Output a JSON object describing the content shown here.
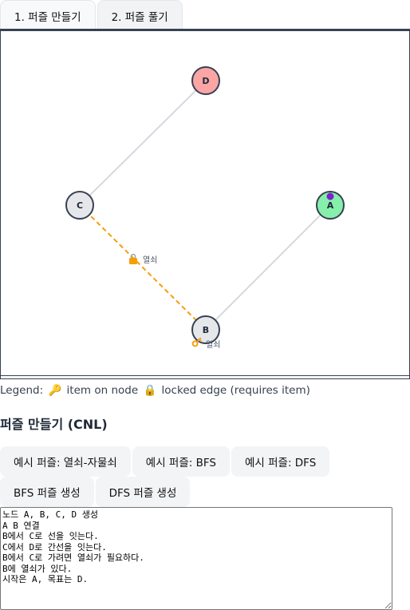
{
  "tabs": [
    {
      "label": "1. 퍼즐 만들기"
    },
    {
      "label": "2. 퍼즐 풀기"
    }
  ],
  "graph": {
    "nodes": [
      {
        "id": "D",
        "label": "D",
        "fill": "#fca5a5"
      },
      {
        "id": "C",
        "label": "C",
        "fill": "#e5e7eb"
      },
      {
        "id": "A",
        "label": "A",
        "fill": "#86efac",
        "marker_color": "#7e22ce"
      },
      {
        "id": "B",
        "label": "B",
        "fill": "#e5e7eb",
        "item_label": "열쇠",
        "item_icon": "key-icon"
      }
    ],
    "edges": [
      {
        "from": "C",
        "to": "D",
        "style": "normal",
        "color": "#d1d5db"
      },
      {
        "from": "A",
        "to": "B",
        "style": "normal",
        "color": "#d1d5db"
      },
      {
        "from": "C",
        "to": "B",
        "style": "locked",
        "color": "#f59e0b",
        "label": "열쇠",
        "icon": "lock-icon"
      }
    ]
  },
  "legend": {
    "prefix": "Legend:",
    "key_icon": "🔑",
    "item_text": "item on node",
    "lock_icon": "🔒",
    "locked_text": "locked edge (requires item)"
  },
  "section_title": "퍼즐 만들기 (CNL)",
  "buttons_row1": [
    "예시 퍼즐: 열쇠-자물쇠",
    "예시 퍼즐: BFS",
    "예시 퍼즐: DFS"
  ],
  "buttons_row2": [
    "BFS 퍼즐 생성",
    "DFS 퍼즐 생성"
  ],
  "cnl_text": "노드 A, B, C, D 생성\nA B 연결\nB에서 C로 선을 잇는다.\nC에서 D로 간선을 잇는다.\nB에서 C로 가려면 열쇠가 필요하다.\nB에 열쇠가 있다.\n시작은 A, 목표는 D."
}
